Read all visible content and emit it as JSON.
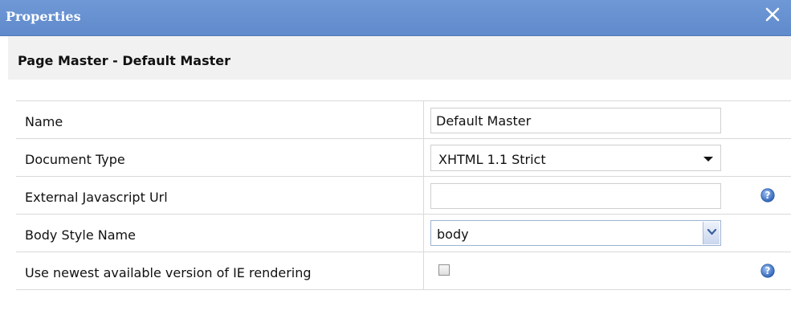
{
  "dialog": {
    "title": "Properties"
  },
  "header": {
    "page_title": "Page Master - Default Master"
  },
  "properties": [
    {
      "label": "Name",
      "control": "text",
      "value": "Default Master"
    },
    {
      "label": "Document Type",
      "control": "select",
      "value": "XHTML 1.1 Strict"
    },
    {
      "label": "External Javascript Url",
      "control": "text",
      "value": "",
      "help_icon": "help-icon"
    },
    {
      "label": "Body Style Name",
      "control": "select",
      "value": "body"
    },
    {
      "label": "Use newest available version of IE rendering",
      "control": "checkbox",
      "checked": false,
      "help_icon": "help-icon"
    }
  ],
  "colors": {
    "titlebar": "#6a93d3",
    "header_bg": "#f1f1f1",
    "grid_line": "#d9d9d9",
    "help_icon": "#3b73c9"
  }
}
